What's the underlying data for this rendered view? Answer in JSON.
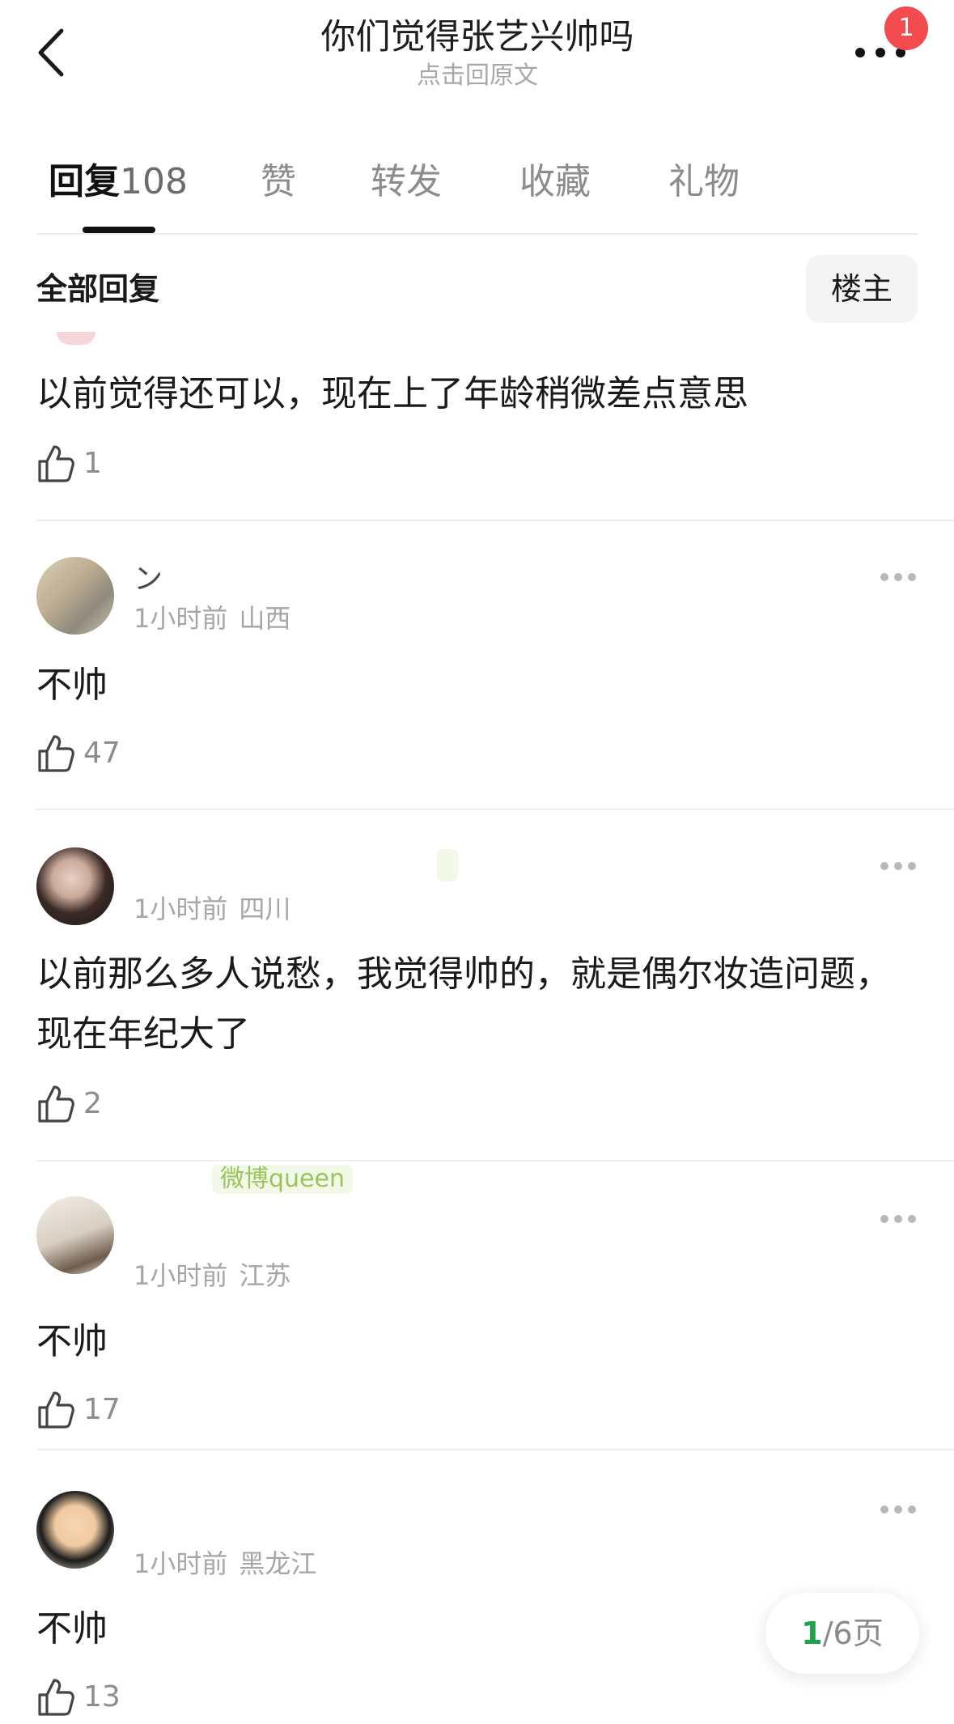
{
  "header": {
    "title": "你们觉得张艺兴帅吗",
    "subtitle": "点击回原文",
    "badge_count": "1",
    "icons": {
      "back": "back-chevron-icon",
      "more": "more-dots-icon"
    }
  },
  "tabs": [
    {
      "label": "回复",
      "count": "108",
      "active": true
    },
    {
      "label": "赞"
    },
    {
      "label": "转发"
    },
    {
      "label": "收藏"
    },
    {
      "label": "礼物"
    }
  ],
  "filter": {
    "label": "全部回复",
    "owner_button": "楼主"
  },
  "comments": [
    {
      "content": "以前觉得还可以，现在上了年龄稍微差点意思",
      "likes": "1"
    },
    {
      "nickname": "ン",
      "time": "1小时前",
      "location": "山西",
      "content": "不帅",
      "likes": "47"
    },
    {
      "nickname": "",
      "time": "1小时前",
      "location": "四川",
      "content": "以前那么多人说愁，我觉得帅的，就是偶尔妆造问题，现在年纪大了",
      "likes": "2"
    },
    {
      "nickname": "",
      "tag": "微博queen",
      "time": "1小时前",
      "location": "江苏",
      "content": "不帅",
      "likes": "17"
    },
    {
      "nickname": "",
      "time": "1小时前",
      "location": "黑龙江",
      "content": "不帅",
      "likes": "13"
    }
  ],
  "pagination": {
    "current": "1",
    "total": "/6页"
  },
  "colors": {
    "badge": "#f24c4f",
    "page_current": "#1fa34a",
    "tag_text": "#9bc45b"
  }
}
